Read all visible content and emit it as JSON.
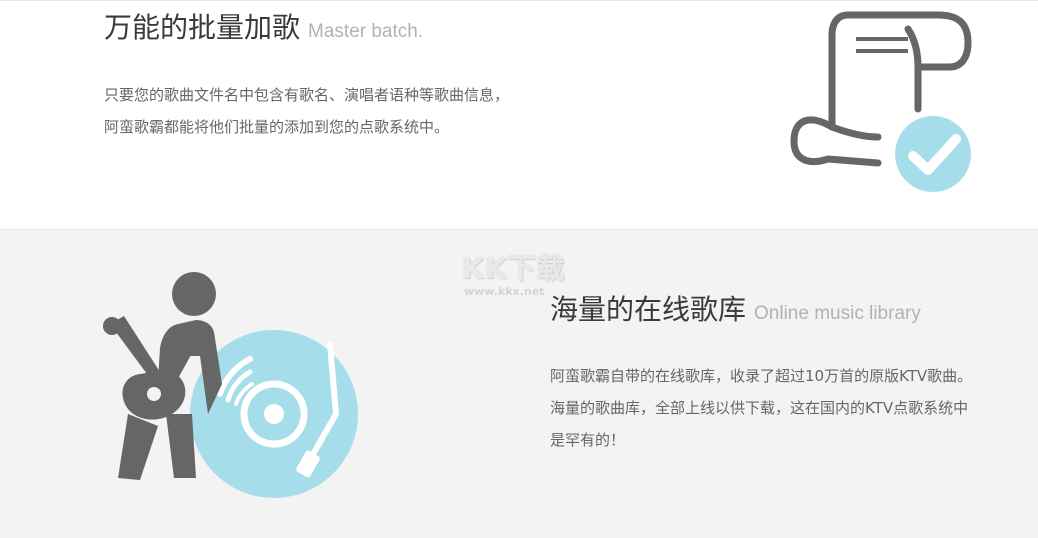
{
  "features": {
    "batch": {
      "title": "万能的批量加歌",
      "subtitle": "Master batch.",
      "description": "只要您的歌曲文件名中包含有歌名、演唱者语种等歌曲信息，阿蛮歌霸都能将他们批量的添加到您的点歌系统中。",
      "icon": "scroll-check-icon"
    },
    "library": {
      "title": "海量的在线歌库",
      "subtitle": "Online music library",
      "description": "阿蛮歌霸自带的在线歌库，收录了超过10万首的原版KTV歌曲。海量的歌曲库，全部上线以供下载，这在国内的KTV点歌系统中是罕有的！",
      "icon": "guitarist-vinyl-icon"
    }
  },
  "watermark": {
    "logo": "KK下载",
    "url": "www.kkx.net"
  },
  "colors": {
    "icon_gray": "#666666",
    "icon_accent": "#a5ddeb",
    "bottom_bg": "#f3f3f3"
  }
}
